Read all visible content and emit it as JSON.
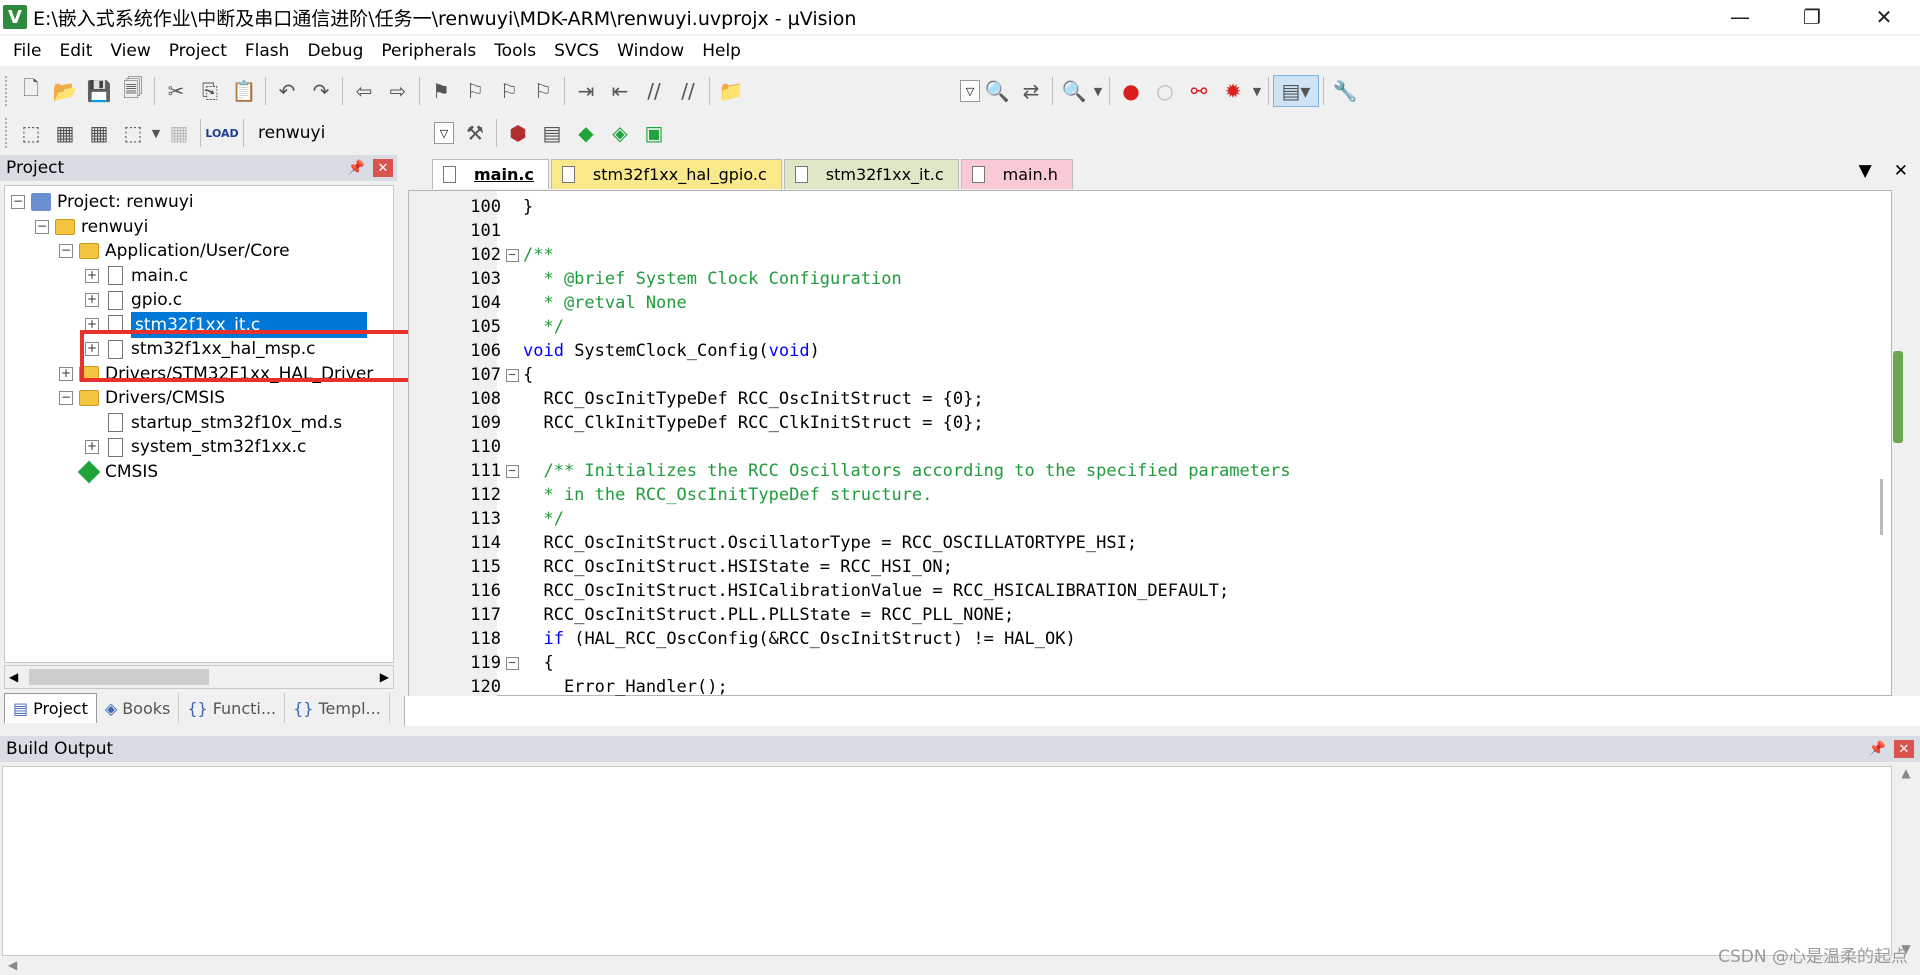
{
  "window": {
    "title": "E:\\嵌入式系统作业\\中断及串口通信进阶\\任务一\\renwuyi\\MDK-ARM\\renwuyi.uvprojx - µVision",
    "app_icon": "V",
    "minimize": "—",
    "maximize": "❐",
    "close": "✕"
  },
  "menu": [
    "File",
    "Edit",
    "View",
    "Project",
    "Flash",
    "Debug",
    "Peripherals",
    "Tools",
    "SVCS",
    "Window",
    "Help"
  ],
  "toolbar2": {
    "target_name": "renwuyi"
  },
  "project_panel": {
    "title": "Project",
    "tree": [
      {
        "label": "Project: renwuyi",
        "level": 0,
        "kind": "project",
        "expander": "−"
      },
      {
        "label": "renwuyi",
        "level": 1,
        "kind": "target",
        "expander": "−"
      },
      {
        "label": "Application/User/Core",
        "level": 2,
        "kind": "folder",
        "expander": "−"
      },
      {
        "label": "main.c",
        "level": 3,
        "kind": "file",
        "expander": "+"
      },
      {
        "label": "gpio.c",
        "level": 3,
        "kind": "file",
        "expander": "+"
      },
      {
        "label": "stm32f1xx_it.c",
        "level": 3,
        "kind": "file",
        "expander": "+",
        "selected": true
      },
      {
        "label": "stm32f1xx_hal_msp.c",
        "level": 3,
        "kind": "file",
        "expander": "+"
      },
      {
        "label": "Drivers/STM32F1xx_HAL_Driver",
        "level": 2,
        "kind": "folder",
        "expander": "+"
      },
      {
        "label": "Drivers/CMSIS",
        "level": 2,
        "kind": "folder",
        "expander": "−"
      },
      {
        "label": "startup_stm32f10x_md.s",
        "level": 3,
        "kind": "file",
        "expander": ""
      },
      {
        "label": "system_stm32f1xx.c",
        "level": 3,
        "kind": "file",
        "expander": "+"
      },
      {
        "label": "CMSIS",
        "level": 2,
        "kind": "component",
        "expander": ""
      }
    ],
    "tabs": [
      {
        "label": "Project",
        "icon": "▤"
      },
      {
        "label": "Books",
        "icon": "◈"
      },
      {
        "label": "Functi...",
        "icon": "{}"
      },
      {
        "label": "Templ...",
        "icon": "{}"
      }
    ]
  },
  "editor": {
    "tabs": [
      {
        "label": "main.c",
        "active": true
      },
      {
        "label": "stm32f1xx_hal_gpio.c",
        "active": false
      },
      {
        "label": "stm32f1xx_it.c",
        "active": false
      },
      {
        "label": "main.h",
        "active": false
      }
    ],
    "lines": [
      {
        "n": "100",
        "fold": "",
        "text": "}",
        "cls": ""
      },
      {
        "n": "101",
        "fold": "",
        "text": "",
        "cls": ""
      },
      {
        "n": "102",
        "fold": "−",
        "text": "/**",
        "cls": "c-comment"
      },
      {
        "n": "103",
        "fold": "",
        "text": "  * @brief System Clock Configuration",
        "cls": "c-comment"
      },
      {
        "n": "104",
        "fold": "",
        "text": "  * @retval None",
        "cls": "c-comment"
      },
      {
        "n": "105",
        "fold": "",
        "text": "  */",
        "cls": "c-comment"
      },
      {
        "n": "106",
        "fold": "",
        "text": "void SystemClock_Config(void)",
        "cls": "kwline"
      },
      {
        "n": "107",
        "fold": "−",
        "text": "{",
        "cls": ""
      },
      {
        "n": "108",
        "fold": "",
        "text": "  RCC_OscInitTypeDef RCC_OscInitStruct = {0};",
        "cls": ""
      },
      {
        "n": "109",
        "fold": "",
        "text": "  RCC_ClkInitTypeDef RCC_ClkInitStruct = {0};",
        "cls": ""
      },
      {
        "n": "110",
        "fold": "",
        "text": "",
        "cls": ""
      },
      {
        "n": "111",
        "fold": "−",
        "text": "  /** Initializes the RCC Oscillators according to the specified parameters",
        "cls": "c-comment"
      },
      {
        "n": "112",
        "fold": "",
        "text": "  * in the RCC_OscInitTypeDef structure.",
        "cls": "c-comment"
      },
      {
        "n": "113",
        "fold": "",
        "text": "  */",
        "cls": "c-comment"
      },
      {
        "n": "114",
        "fold": "",
        "text": "  RCC_OscInitStruct.OscillatorType = RCC_OSCILLATORTYPE_HSI;",
        "cls": ""
      },
      {
        "n": "115",
        "fold": "",
        "text": "  RCC_OscInitStruct.HSIState = RCC_HSI_ON;",
        "cls": ""
      },
      {
        "n": "116",
        "fold": "",
        "text": "  RCC_OscInitStruct.HSICalibrationValue = RCC_HSICALIBRATION_DEFAULT;",
        "cls": ""
      },
      {
        "n": "117",
        "fold": "",
        "text": "  RCC_OscInitStruct.PLL.PLLState = RCC_PLL_NONE;",
        "cls": ""
      },
      {
        "n": "118",
        "fold": "",
        "text": "  if (HAL_RCC_OscConfig(&RCC_OscInitStruct) != HAL_OK)",
        "cls": "ifline"
      },
      {
        "n": "119",
        "fold": "−",
        "text": "  {",
        "cls": ""
      },
      {
        "n": "120",
        "fold": "",
        "text": "    Error_Handler();",
        "cls": ""
      }
    ]
  },
  "build_output": {
    "title": "Build Output"
  },
  "watermark": "CSDN @心是温柔的起点",
  "colors": {
    "selection": "#0078d7",
    "comment": "#1f9c3a",
    "keyword": "#0000ff",
    "highlight_box": "#e8302c"
  }
}
